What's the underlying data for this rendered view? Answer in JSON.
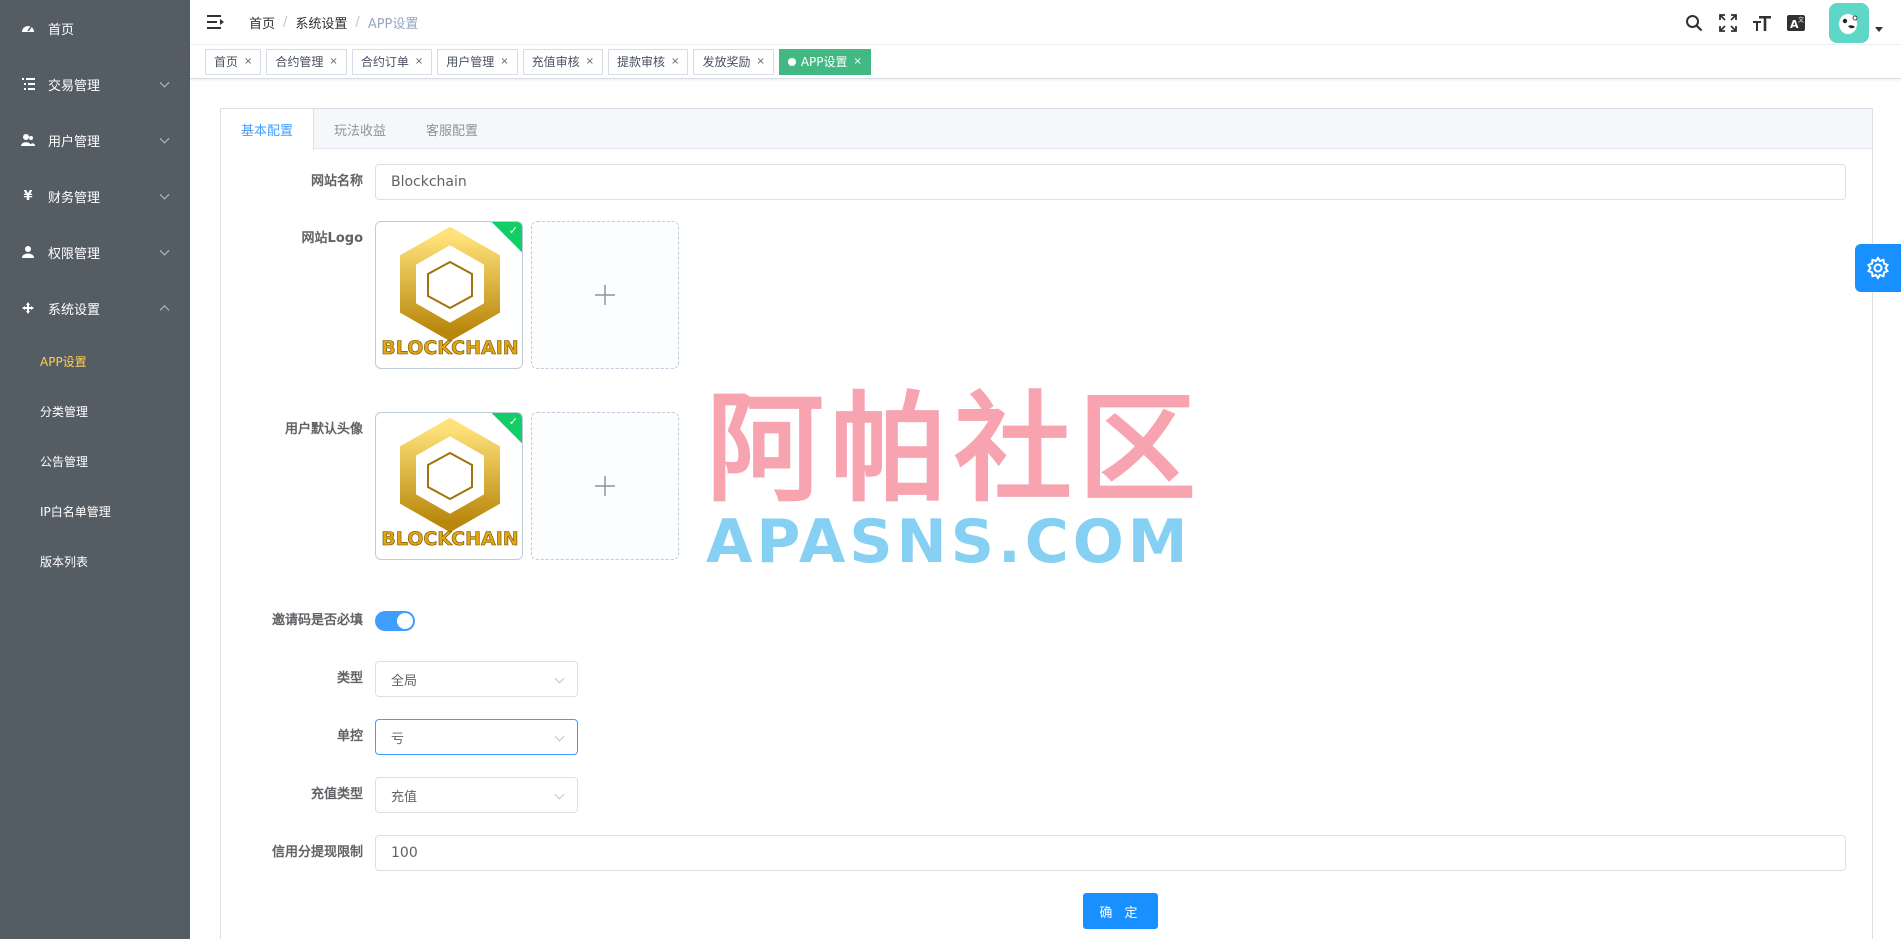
{
  "sidebar": {
    "home": "首页",
    "items": [
      {
        "label": "交易管理",
        "icon": "list-icon"
      },
      {
        "label": "用户管理",
        "icon": "users-icon"
      },
      {
        "label": "财务管理",
        "icon": "yen-icon"
      },
      {
        "label": "权限管理",
        "icon": "user-icon"
      },
      {
        "label": "系统设置",
        "icon": "move-icon"
      }
    ],
    "subitems": [
      "APP设置",
      "分类管理",
      "公告管理",
      "IP白名单管理",
      "版本列表"
    ]
  },
  "breadcrumb": [
    "首页",
    "系统设置",
    "APP设置"
  ],
  "tags": [
    "首页",
    "合约管理",
    "合约订单",
    "用户管理",
    "充值审核",
    "提款审核",
    "发放奖励",
    "APP设置"
  ],
  "tabs": [
    "基本配置",
    "玩法收益",
    "客服配置"
  ],
  "form": {
    "site_name_label": "网站名称",
    "site_name_value": "Blockchain",
    "logo_label": "网站Logo",
    "avatar_label": "用户默认头像",
    "logo_image_text": "BLOCKCHAIN",
    "invite_label": "邀请码是否必填",
    "invite_required": true,
    "type_label": "类型",
    "type_value": "全局",
    "control_label": "单控",
    "control_value": "亏",
    "recharge_label": "充值类型",
    "recharge_value": "充值",
    "credit_label": "信用分提现限制",
    "credit_value": "100",
    "submit": "确 定"
  },
  "watermark": {
    "cn": "阿帕社区",
    "en": "APASNS.COM"
  },
  "colors": {
    "sidebar": "#545c64",
    "active_menu": "#ffd04b",
    "primary": "#1890ff",
    "active_tag": "#42b983"
  }
}
